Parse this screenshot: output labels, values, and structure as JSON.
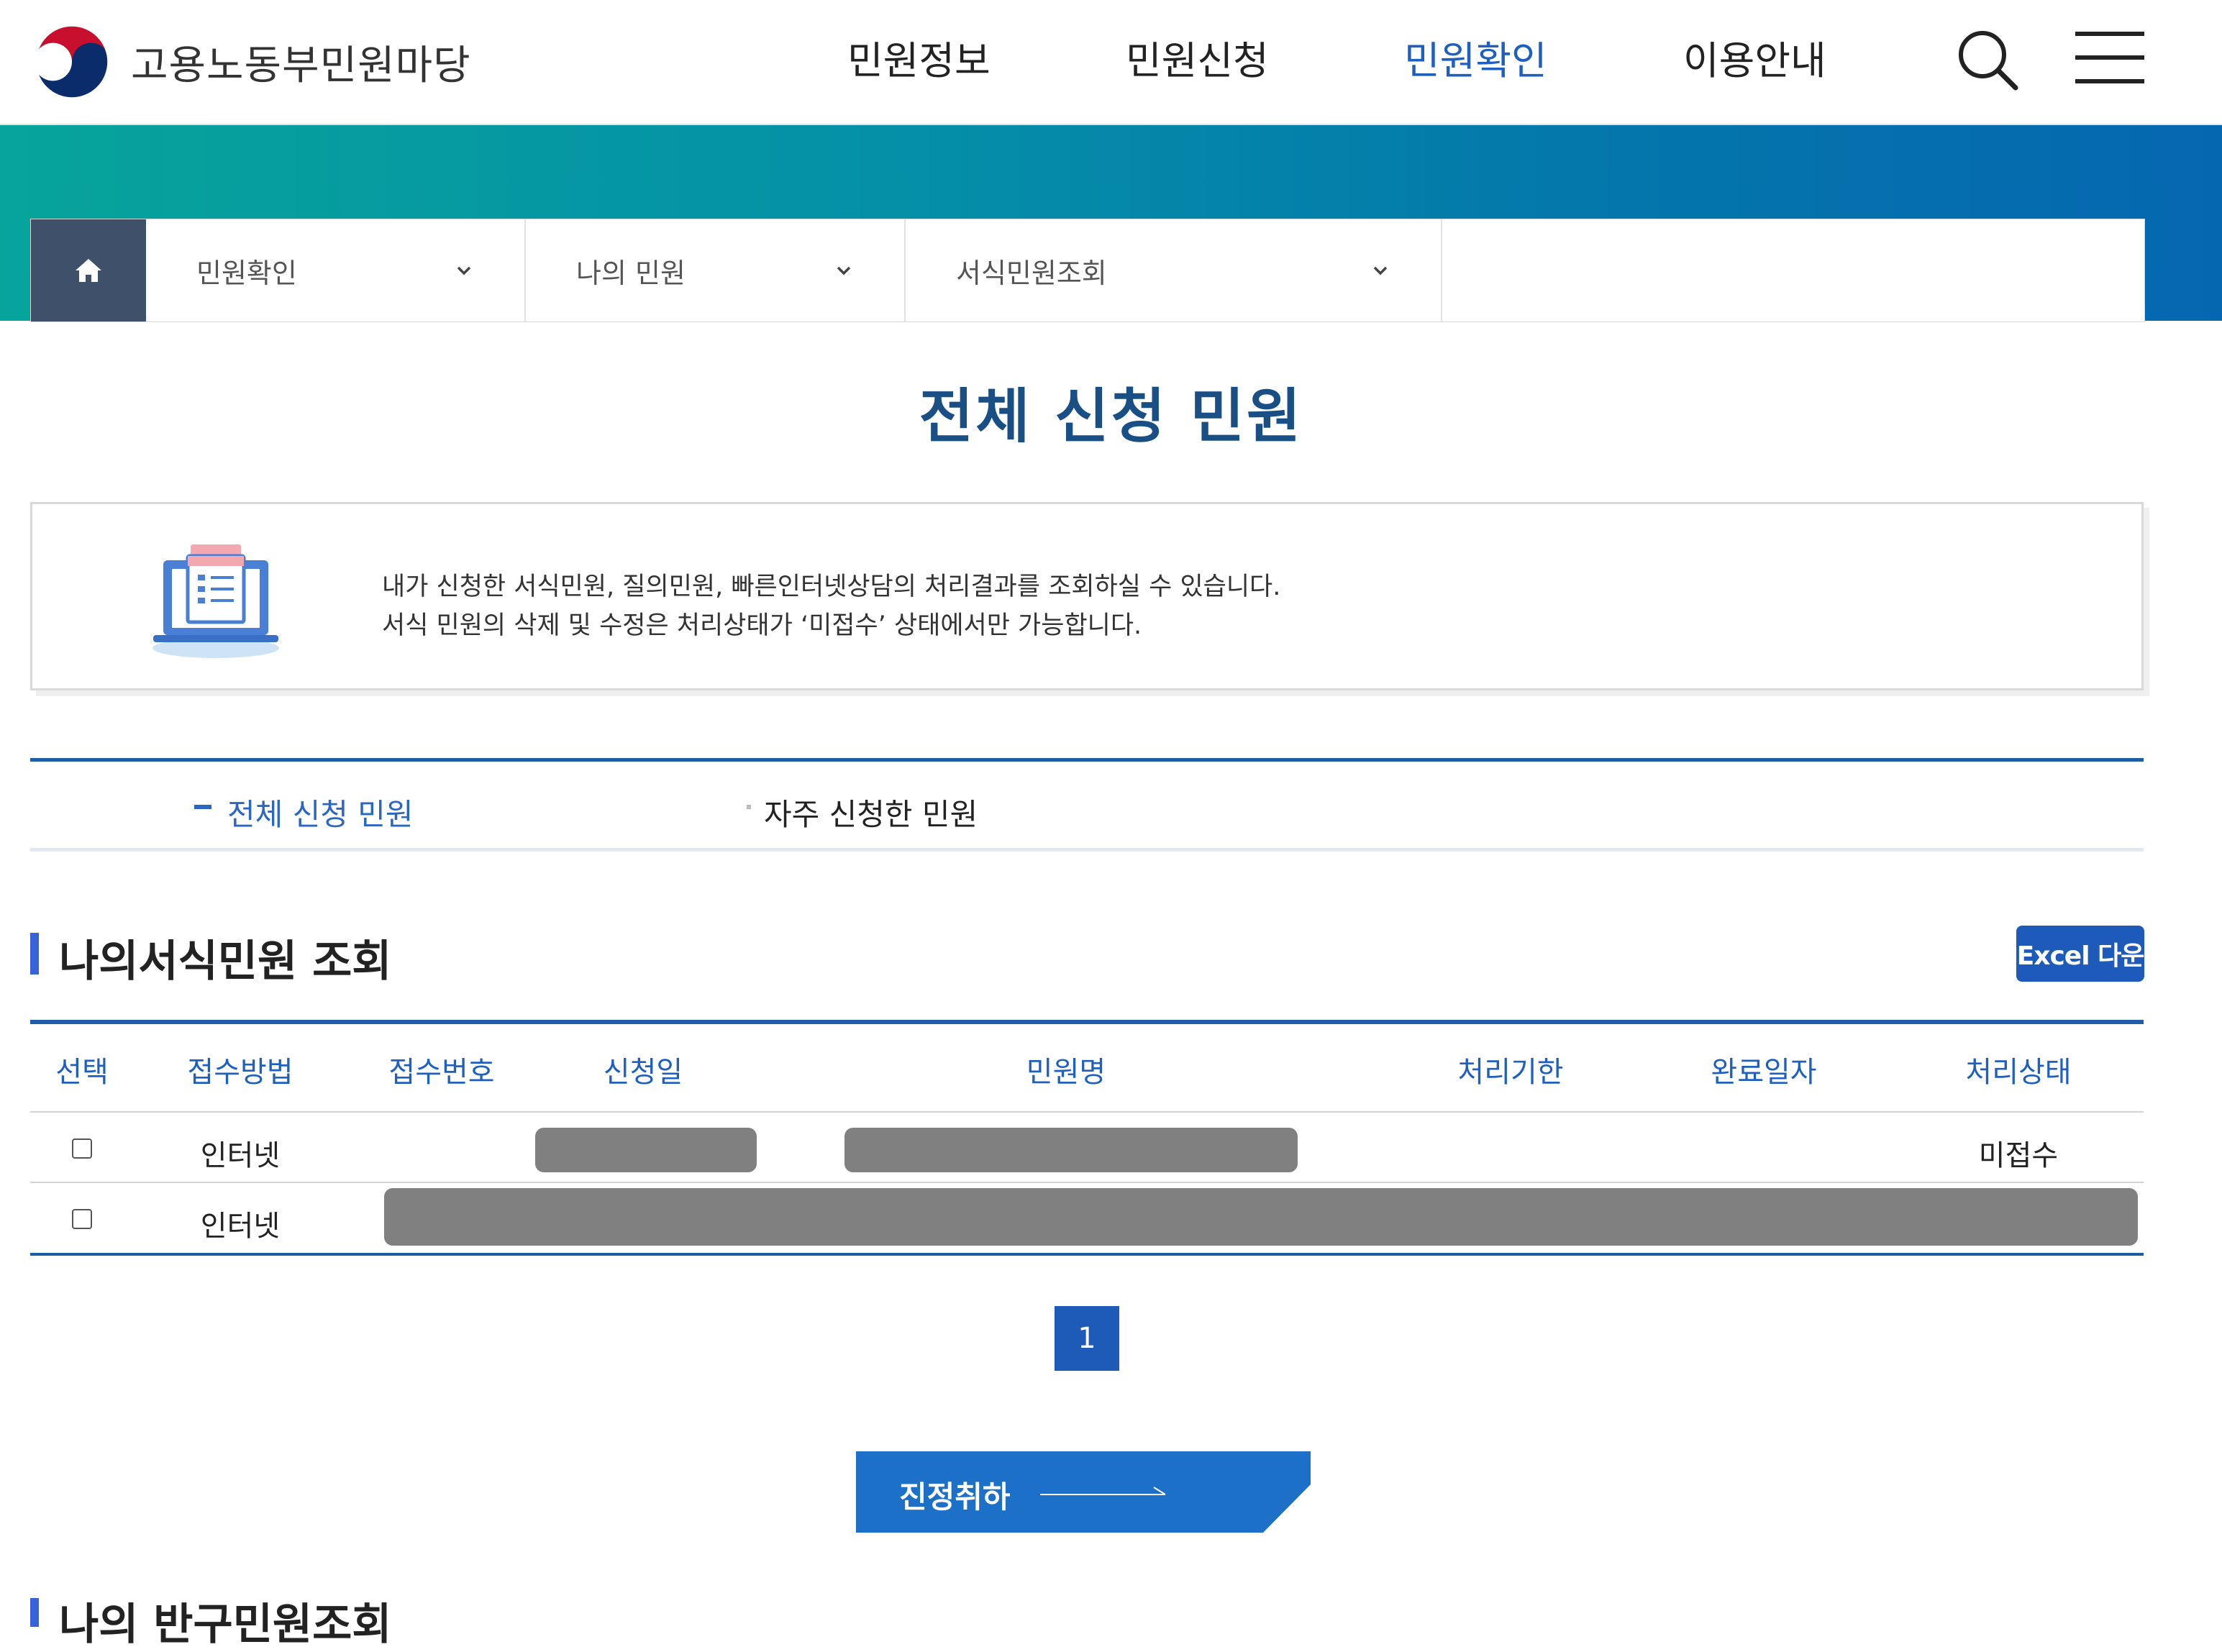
{
  "header": {
    "site_name": "고용노동부민원마당",
    "nav": [
      "민원정보",
      "민원신청",
      "민원확인",
      "이용안내"
    ],
    "active_nav": "민원확인"
  },
  "breadcrumb": [
    "민원확인",
    "나의 민원",
    "서식민원조회"
  ],
  "page_title": "전체 신청 민원",
  "info": {
    "line1": "내가 신청한 서식민원, 질의민원, 빠른인터넷상담의 처리결과를 조회하실 수 있습니다.",
    "line2": "서식 민원의 삭제 및 수정은 처리상태가 ‘미접수’ 상태에서만 가능합니다."
  },
  "tabs": [
    "전체 신청 민원",
    "자주 신청한 민원"
  ],
  "section": {
    "title": "나의서식민원 조회",
    "excel_button": "Excel 다운"
  },
  "table": {
    "headers": [
      "선택",
      "접수방법",
      "접수번호",
      "신청일",
      "민원명",
      "처리기한",
      "완료일자",
      "처리상태"
    ],
    "rows": [
      {
        "method": "인터넷",
        "status": "미접수"
      },
      {
        "method": "인터넷",
        "status": ""
      }
    ]
  },
  "pagination": {
    "current": "1"
  },
  "withdraw_button": "진정취하",
  "section2_title": "나의 반구민원조회",
  "colors": {
    "primary": "#1e5ea8",
    "accent": "#2a66c2",
    "title": "#1a4f86",
    "home_btn": "#3f506a"
  }
}
